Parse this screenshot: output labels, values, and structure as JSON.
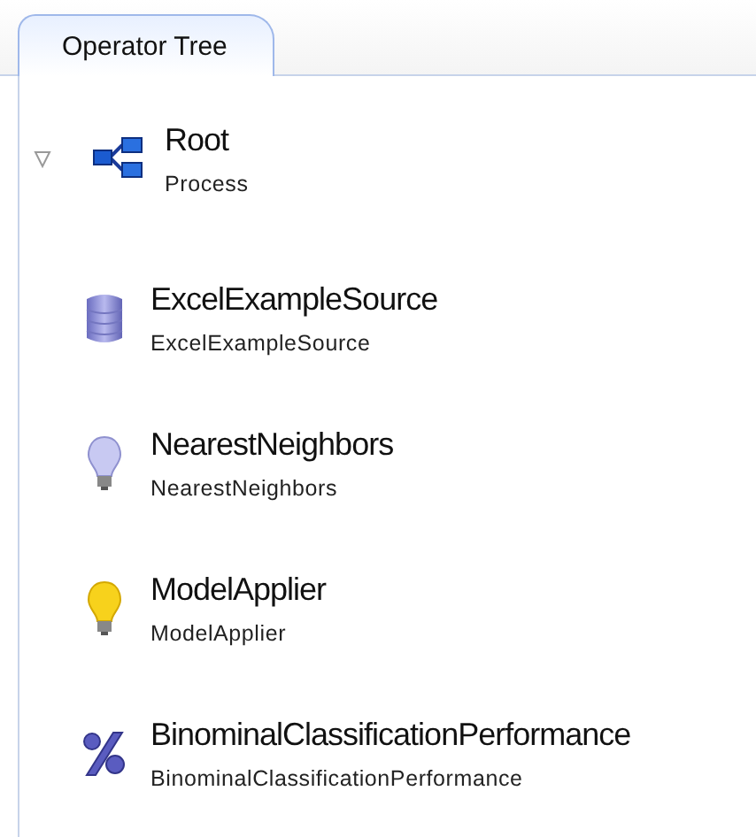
{
  "tabs": [
    {
      "label": "Operator Tree",
      "selected": true
    }
  ],
  "tree": {
    "name": "Root",
    "type": "Process",
    "kind": "process",
    "expanded": true,
    "children": [
      {
        "name": "ExcelExampleSource",
        "type": "ExcelExampleSource",
        "kind": "database"
      },
      {
        "name": "NearestNeighbors",
        "type": "NearestNeighbors",
        "kind": "bulb-off"
      },
      {
        "name": "ModelApplier",
        "type": "ModelApplier",
        "kind": "bulb-on"
      },
      {
        "name": "BinominalClassificationPerformance",
        "type": "BinominalClassificationPerformance",
        "kind": "percent"
      }
    ]
  }
}
